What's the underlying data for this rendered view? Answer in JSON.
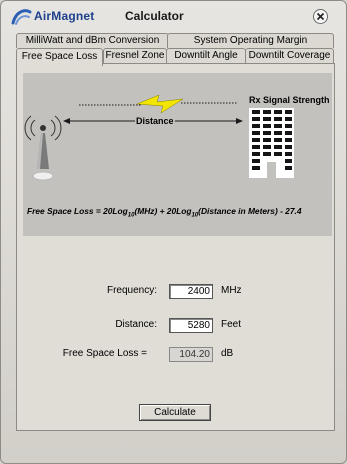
{
  "window": {
    "brand": "AirMagnet",
    "title": "Calculator"
  },
  "tabs": {
    "top_row": [
      "MilliWatt and dBm Conversion",
      "System Operating Margin"
    ],
    "bottom_row": [
      "Free Space Loss",
      "Fresnel Zone",
      "Downtilt Angle",
      "Downtilt Coverage"
    ],
    "active": "Free Space Loss"
  },
  "diagram": {
    "distance_label": "Distance",
    "rx_label": "Rx Signal Strength",
    "formula_prefix": "Free Space Loss = 20Log",
    "formula_sub": "10",
    "formula_mid": "(MHz) + 20Log",
    "formula_end": "(Distance in Meters) - 27.4"
  },
  "fields": {
    "frequency": {
      "label": "Frequency:",
      "value": "2400",
      "unit": "MHz"
    },
    "distance": {
      "label": "Distance:",
      "value": "5280",
      "unit": "Feet"
    },
    "free_space_loss": {
      "label": "Free Space Loss =",
      "value": "104.20",
      "unit": "dB"
    }
  },
  "buttons": {
    "calculate": "Calculate"
  },
  "colors": {
    "brand_blue": "#1c3f8c",
    "lightning_yellow": "#f2e600",
    "diagram_bg": "#c3c1bd"
  },
  "icons": [
    "airmagnet-logo-icon",
    "close-icon",
    "antenna-tower-icon",
    "lightning-bolt-icon",
    "building-icon"
  ]
}
